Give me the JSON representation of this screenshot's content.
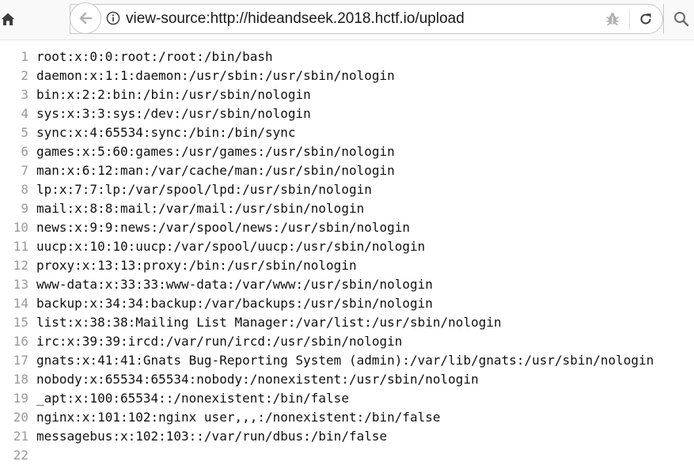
{
  "browser": {
    "url": "view-source:http://hideandseek.2018.hctf.io/upload",
    "icons": {
      "home": "home-icon",
      "back": "back-arrow-icon",
      "info": "info-icon",
      "shield": "tracking-protection-icon",
      "reload": "reload-icon",
      "search": "search-icon"
    }
  },
  "source": {
    "lines": [
      {
        "num": "1",
        "text": "root:x:0:0:root:/root:/bin/bash"
      },
      {
        "num": "2",
        "text": "daemon:x:1:1:daemon:/usr/sbin:/usr/sbin/nologin"
      },
      {
        "num": "3",
        "text": "bin:x:2:2:bin:/bin:/usr/sbin/nologin"
      },
      {
        "num": "4",
        "text": "sys:x:3:3:sys:/dev:/usr/sbin/nologin"
      },
      {
        "num": "5",
        "text": "sync:x:4:65534:sync:/bin:/bin/sync"
      },
      {
        "num": "6",
        "text": "games:x:5:60:games:/usr/games:/usr/sbin/nologin"
      },
      {
        "num": "7",
        "text": "man:x:6:12:man:/var/cache/man:/usr/sbin/nologin"
      },
      {
        "num": "8",
        "text": "lp:x:7:7:lp:/var/spool/lpd:/usr/sbin/nologin"
      },
      {
        "num": "9",
        "text": "mail:x:8:8:mail:/var/mail:/usr/sbin/nologin"
      },
      {
        "num": "10",
        "text": "news:x:9:9:news:/var/spool/news:/usr/sbin/nologin"
      },
      {
        "num": "11",
        "text": "uucp:x:10:10:uucp:/var/spool/uucp:/usr/sbin/nologin"
      },
      {
        "num": "12",
        "text": "proxy:x:13:13:proxy:/bin:/usr/sbin/nologin"
      },
      {
        "num": "13",
        "text": "www-data:x:33:33:www-data:/var/www:/usr/sbin/nologin"
      },
      {
        "num": "14",
        "text": "backup:x:34:34:backup:/var/backups:/usr/sbin/nologin"
      },
      {
        "num": "15",
        "text": "list:x:38:38:Mailing List Manager:/var/list:/usr/sbin/nologin"
      },
      {
        "num": "16",
        "text": "irc:x:39:39:ircd:/var/run/ircd:/usr/sbin/nologin"
      },
      {
        "num": "17",
        "text": "gnats:x:41:41:Gnats Bug-Reporting System (admin):/var/lib/gnats:/usr/sbin/nologin"
      },
      {
        "num": "18",
        "text": "nobody:x:65534:65534:nobody:/nonexistent:/usr/sbin/nologin"
      },
      {
        "num": "19",
        "text": "_apt:x:100:65534::/nonexistent:/bin/false"
      },
      {
        "num": "20",
        "text": "nginx:x:101:102:nginx user,,,:/nonexistent:/bin/false"
      },
      {
        "num": "21",
        "text": "messagebus:x:102:103::/var/run/dbus:/bin/false"
      },
      {
        "num": "22",
        "text": ""
      }
    ]
  }
}
